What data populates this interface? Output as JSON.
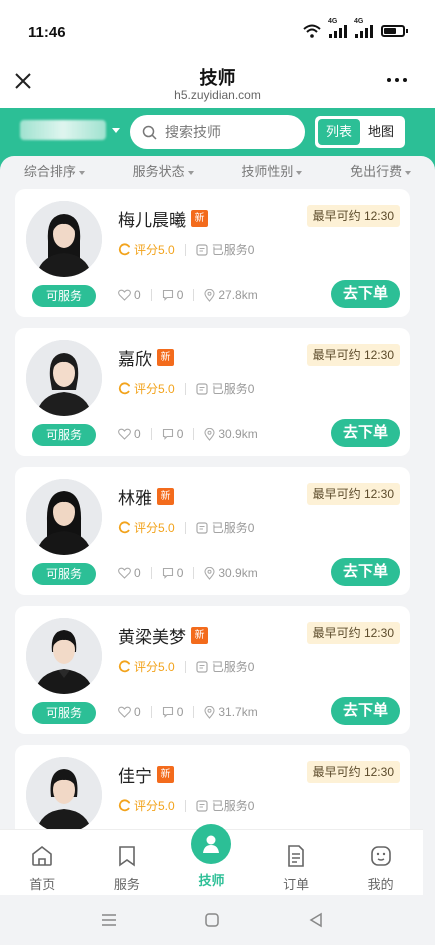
{
  "status_bar": {
    "time": "11:46",
    "network": "4G"
  },
  "header": {
    "title": "技师",
    "url": "h5.zuyidian.com"
  },
  "search": {
    "placeholder": "搜索技师"
  },
  "view_toggle": {
    "list": "列表",
    "map": "地图"
  },
  "filters": [
    "综合排序",
    "服务状态",
    "技师性别",
    "免出行费"
  ],
  "technicians": [
    {
      "name": "梅儿晨曦",
      "badge": "新",
      "earliest": "最早可约 12:30",
      "rating": "评分5.0",
      "served": "已服务0",
      "likes": "0",
      "comments": "0",
      "distance": "27.8km",
      "status": "可服务",
      "action": "去下单"
    },
    {
      "name": "嘉欣",
      "badge": "新",
      "earliest": "最早可约 12:30",
      "rating": "评分5.0",
      "served": "已服务0",
      "likes": "0",
      "comments": "0",
      "distance": "30.9km",
      "status": "可服务",
      "action": "去下单"
    },
    {
      "name": "林雅",
      "badge": "新",
      "earliest": "最早可约 12:30",
      "rating": "评分5.0",
      "served": "已服务0",
      "likes": "0",
      "comments": "0",
      "distance": "30.9km",
      "status": "可服务",
      "action": "去下单"
    },
    {
      "name": "黄梁美梦",
      "badge": "新",
      "earliest": "最早可约 12:30",
      "rating": "评分5.0",
      "served": "已服务0",
      "likes": "0",
      "comments": "0",
      "distance": "31.7km",
      "status": "可服务",
      "action": "去下单"
    },
    {
      "name": "佳宁",
      "badge": "新",
      "earliest": "最早可约 12:30",
      "rating": "评分5.0",
      "served": "已服务0",
      "likes": "",
      "comments": "",
      "distance": "",
      "status": "",
      "action": ""
    }
  ],
  "tabs": [
    "首页",
    "服务",
    "技师",
    "订单",
    "我的"
  ],
  "colors": {
    "accent": "#2cbf96",
    "new_badge": "#f36b1c",
    "rating": "#f2a31c",
    "earliest_bg": "#fdf1d6"
  }
}
